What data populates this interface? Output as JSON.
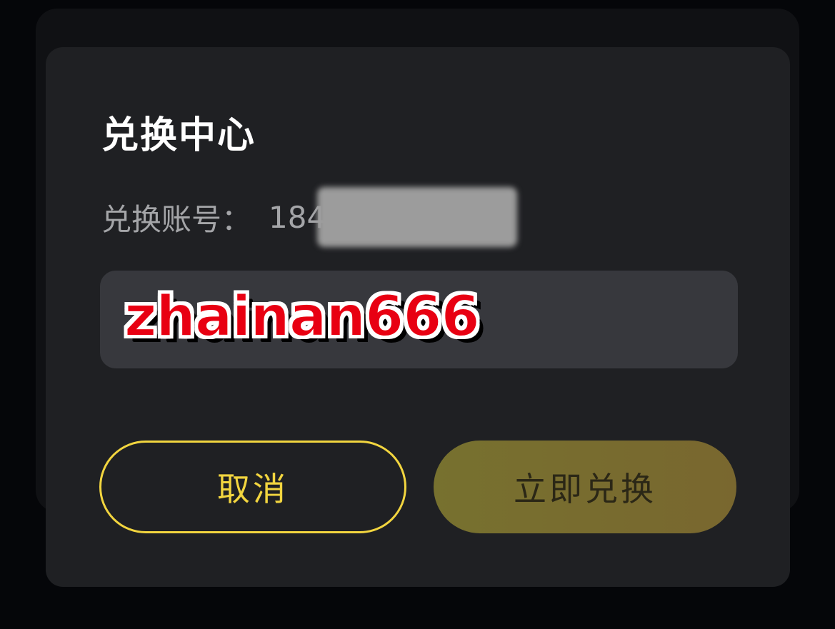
{
  "dialog": {
    "title": "兑换中心",
    "account_label": "兑换账号",
    "account_separator": "：",
    "account_value_visible": "184",
    "code_input": {
      "value": "",
      "placeholder": ""
    },
    "overlay_text": "zhainan666",
    "cancel_label": "取消",
    "redeem_label": "立即兑换"
  },
  "colors": {
    "background": "#050609",
    "dialog": "#1f2023",
    "input": "#37383d",
    "accent": "#f2d53f",
    "redeem": "#77712f",
    "overlay_text": "#e80012"
  }
}
